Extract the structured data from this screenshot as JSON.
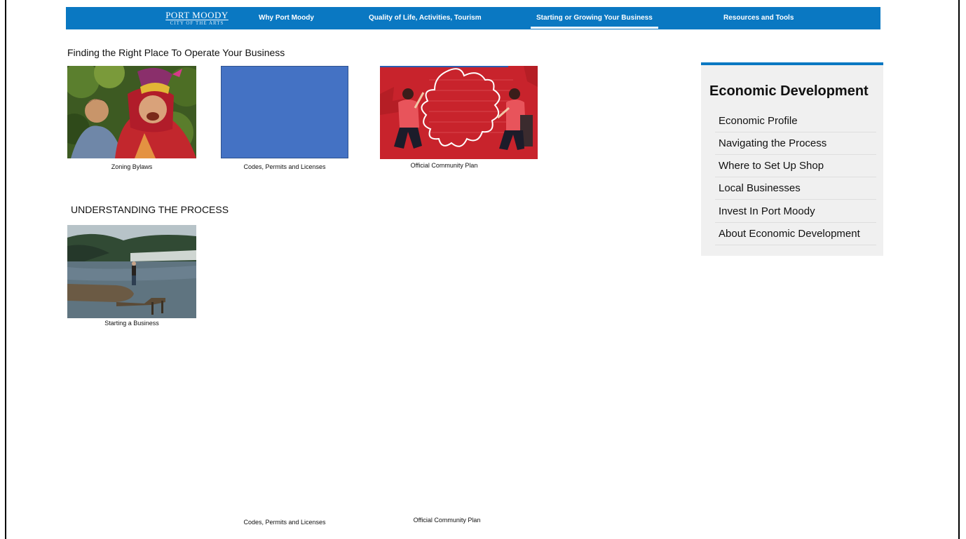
{
  "nav": {
    "logo_line1": "PORT MOODY",
    "logo_line2": "CITY OF THE ARTS",
    "links": [
      {
        "label": "Why Port Moody"
      },
      {
        "label": "Quality of Life, Activities, Tourism"
      },
      {
        "label": "Starting or Growing Your Business",
        "active": true
      },
      {
        "label": "Resources and Tools"
      }
    ]
  },
  "main": {
    "section1_title": "Finding the Right Place To Operate Your Business",
    "section2_title": "UNDERSTANDING THE PROCESS",
    "cards": [
      {
        "caption": "Zoning Bylaws"
      },
      {
        "caption": "Codes, Permits and Licenses"
      },
      {
        "caption": "Official Community Plan"
      },
      {
        "caption": "Starting a Business"
      }
    ],
    "footer_captions": [
      "Codes, Permits and Licenses",
      "Official Community Plan"
    ]
  },
  "sidebar": {
    "title": "Economic Development",
    "items": [
      {
        "label": "Economic Profile"
      },
      {
        "label": "Navigating the Process"
      },
      {
        "label": "Where to Set Up Shop"
      },
      {
        "label": "Local Businesses"
      },
      {
        "label": "Invest In Port Moody"
      },
      {
        "label": "About Economic Development"
      }
    ]
  },
  "colors": {
    "nav_bg": "#0a78c2",
    "placeholder_blue": "#4472c4",
    "plan_red": "#c8232c",
    "sidebar_bg": "#f0f0f0"
  }
}
